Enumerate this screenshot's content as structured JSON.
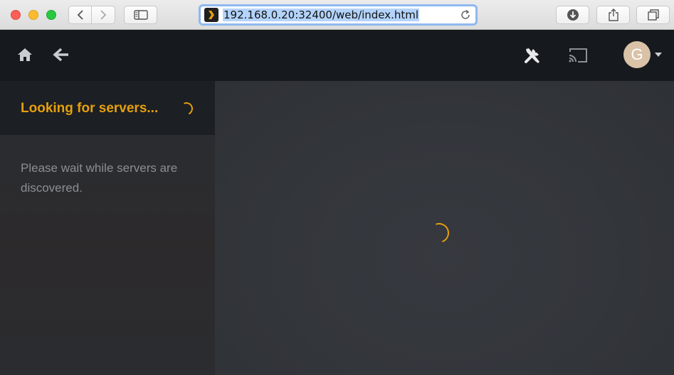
{
  "browser": {
    "url": "192.168.0.20:32400/web/index.html",
    "icons": [
      "back-icon",
      "forward-icon",
      "sidebar-icon",
      "plex-favicon",
      "reload-icon",
      "download-icon",
      "share-icon",
      "tabs-icon"
    ]
  },
  "header": {
    "avatar_letter": "G",
    "icons": [
      "home-icon",
      "back-arrow-icon",
      "settings-tools-icon",
      "cast-icon"
    ]
  },
  "panel": {
    "title": "Looking for servers...",
    "message": "Please wait while servers are discovered."
  },
  "colors": {
    "accent": "#e5a00d",
    "header_bg": "#16191d",
    "panel_header_bg": "#1c1f24"
  }
}
